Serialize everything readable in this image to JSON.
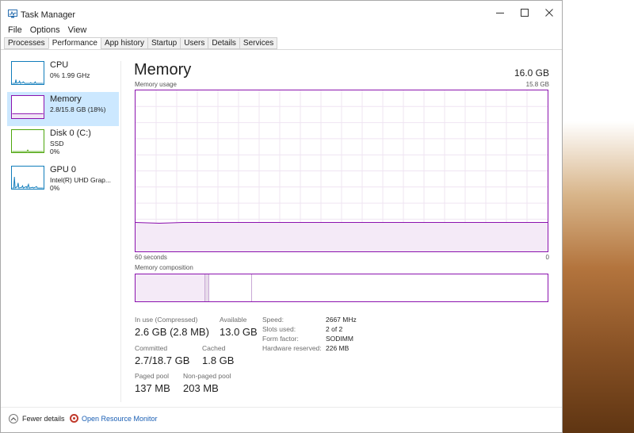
{
  "window": {
    "title": "Task Manager"
  },
  "menu": [
    "File",
    "Options",
    "View"
  ],
  "tabs": [
    {
      "label": "Processes",
      "active": false
    },
    {
      "label": "Performance",
      "active": true
    },
    {
      "label": "App history",
      "active": false
    },
    {
      "label": "Startup",
      "active": false
    },
    {
      "label": "Users",
      "active": false
    },
    {
      "label": "Details",
      "active": false
    },
    {
      "label": "Services",
      "active": false
    }
  ],
  "sidebar": {
    "items": [
      {
        "name": "CPU",
        "sub": "0% 1.99 GHz",
        "sub2": "",
        "icon": "cpu-graph-icon"
      },
      {
        "name": "Memory",
        "sub": "2.8/15.8 GB (18%)",
        "sub2": "",
        "icon": "memory-graph-icon"
      },
      {
        "name": "Disk 0 (C:)",
        "sub": "SSD",
        "sub2": "0%",
        "icon": "disk-graph-icon"
      },
      {
        "name": "GPU 0",
        "sub": "Intel(R) UHD Grap...",
        "sub2": "0%",
        "icon": "gpu-graph-icon"
      }
    ]
  },
  "main": {
    "title": "Memory",
    "total": "16.0 GB",
    "usage_label": "Memory usage",
    "usage_max": "15.8 GB",
    "time_left": "60 seconds",
    "time_right": "0",
    "composition_label": "Memory composition",
    "usage_fraction": 0.18
  },
  "stats": {
    "in_use_label": "In use (Compressed)",
    "in_use_value": "2.6 GB (2.8 MB)",
    "available_label": "Available",
    "available_value": "13.0 GB",
    "committed_label": "Committed",
    "committed_value": "2.7/18.7 GB",
    "cached_label": "Cached",
    "cached_value": "1.8 GB",
    "paged_label": "Paged pool",
    "paged_value": "137 MB",
    "nonpaged_label": "Non-paged pool",
    "nonpaged_value": "203 MB"
  },
  "hardware": [
    {
      "label": "Speed:",
      "value": "2667 MHz"
    },
    {
      "label": "Slots used:",
      "value": "2 of 2"
    },
    {
      "label": "Form factor:",
      "value": "SODIMM"
    },
    {
      "label": "Hardware reserved:",
      "value": "226 MB"
    }
  ],
  "footer": {
    "fewer_details": "Fewer details",
    "resource_monitor": "Open Resource Monitor"
  },
  "colors": {
    "memory_accent": "#8b12ae",
    "cpu_accent": "#117dbb",
    "disk_accent": "#4da60c",
    "selected_bg": "#cce8ff"
  }
}
